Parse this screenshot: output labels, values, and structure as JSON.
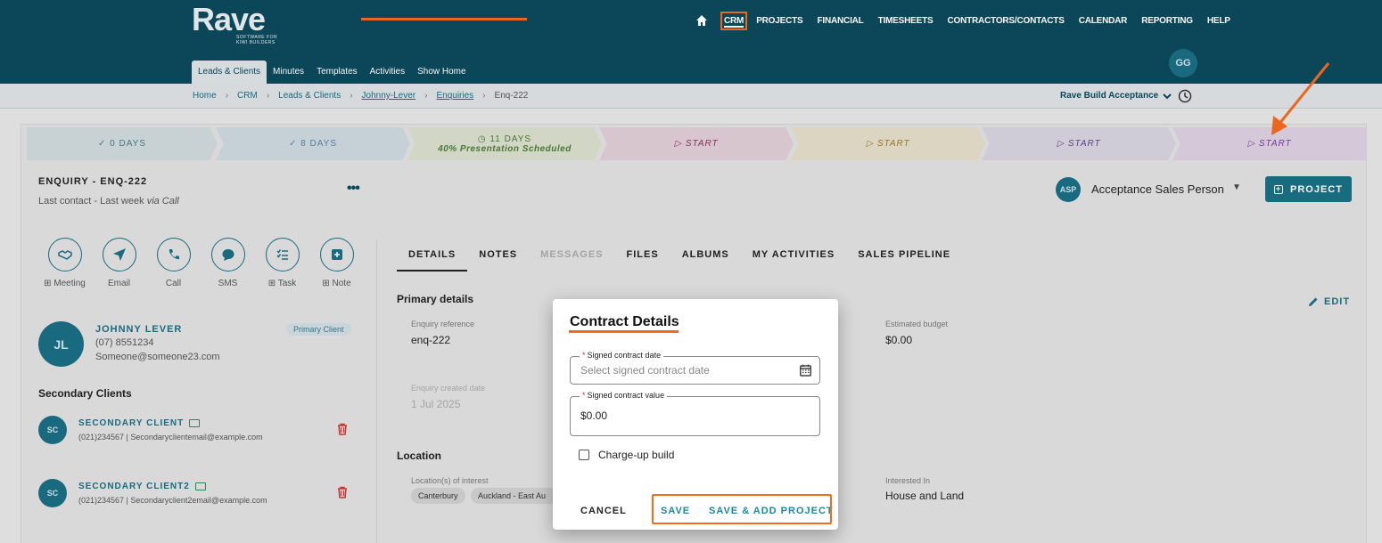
{
  "brand": {
    "name": "Rave",
    "tagline": "SOFTWARE FOR KIWI BUILDERS"
  },
  "colors": {
    "header": "#0c4a5c",
    "accent": "#1a6e84",
    "highlight": "#f46b1e"
  },
  "main_nav": {
    "home_icon": "home-icon",
    "items": [
      "CRM",
      "PROJECTS",
      "FINANCIAL",
      "TIMESHEETS",
      "CONTRACTORS/CONTACTS",
      "CALENDAR",
      "REPORTING",
      "HELP"
    ],
    "active": "CRM"
  },
  "sub_nav": {
    "items": [
      "Leads & Clients",
      "Minutes",
      "Templates",
      "Activities",
      "Show Home"
    ],
    "active": "Leads & Clients"
  },
  "user": {
    "initials": "GG"
  },
  "breadcrumb": [
    "Home",
    "CRM",
    "Leads & Clients",
    "Johnny-Lever",
    "Enquiries",
    "Enq-222"
  ],
  "account_selector": {
    "value": "Rave Build Acceptance"
  },
  "pipeline": [
    {
      "icon": "✓",
      "label": "0 DAYS",
      "sub": ""
    },
    {
      "icon": "✓",
      "label": "8 DAYS",
      "sub": ""
    },
    {
      "icon": "◷",
      "label": "11 DAYS",
      "sub": "40% Presentation Scheduled"
    },
    {
      "icon": "▷",
      "label": "START",
      "sub": ""
    },
    {
      "icon": "▷",
      "label": "START",
      "sub": ""
    },
    {
      "icon": "▷",
      "label": "START",
      "sub": ""
    },
    {
      "icon": "▷",
      "label": "START",
      "sub": ""
    }
  ],
  "enquiry": {
    "title": "ENQUIRY - ENQ-222",
    "last_contact": "Last contact - Last week",
    "via": "via Call"
  },
  "sales_person": {
    "initials": "ASP",
    "name": "Acceptance Sales Person"
  },
  "project_button": "PROJECT",
  "actions": [
    {
      "label": "⊞ Meeting",
      "icon": "handshake-icon"
    },
    {
      "label": "Email",
      "icon": "send-icon"
    },
    {
      "label": "Call",
      "icon": "phone-icon"
    },
    {
      "label": "SMS",
      "icon": "sms-icon"
    },
    {
      "label": "⊞ Task",
      "icon": "task-list-icon"
    },
    {
      "label": "⊞ Note",
      "icon": "note-icon"
    }
  ],
  "primary_client": {
    "initials": "JL",
    "name": "JOHNNY LEVER",
    "phone": "(07) 8551234",
    "email": "Someone@someone23.com",
    "badge": "Primary Client"
  },
  "secondary_heading": "Secondary Clients",
  "secondary_clients": [
    {
      "initials": "SC",
      "name": "SECONDARY CLIENT",
      "meta": "(021)234567  |  Secondaryclientemail@example.com"
    },
    {
      "initials": "SC",
      "name": "SECONDARY CLIENT2",
      "meta": "(021)234567  |  Secondaryclient2email@example.com"
    }
  ],
  "tabs": [
    "DETAILS",
    "NOTES",
    "MESSAGES",
    "FILES",
    "ALBUMS",
    "MY ACTIVITIES",
    "SALES PIPELINE"
  ],
  "details": {
    "primary_heading": "Primary details",
    "edit_label": "EDIT",
    "enquiry_reference_label": "Enquiry reference",
    "enquiry_reference": "enq-222",
    "estimated_budget_label": "Estimated budget",
    "estimated_budget": "$0.00",
    "created_label": "Enquiry created date",
    "created": "1 Jul 2025",
    "location_heading": "Location",
    "locations_label": "Location(s) of interest",
    "locations": [
      "Canterbury",
      "Auckland - East Au"
    ],
    "interested_label": "Interested In",
    "interested": "House and Land"
  },
  "modal": {
    "title": "Contract Details",
    "date_label": "Signed contract date",
    "date_placeholder": "Select signed contract date",
    "value_label": "Signed contract value",
    "value": "$0.00",
    "checkbox_label": "Charge-up build",
    "cancel": "CANCEL",
    "save": "SAVE",
    "save_add": "SAVE & ADD PROJECT"
  }
}
